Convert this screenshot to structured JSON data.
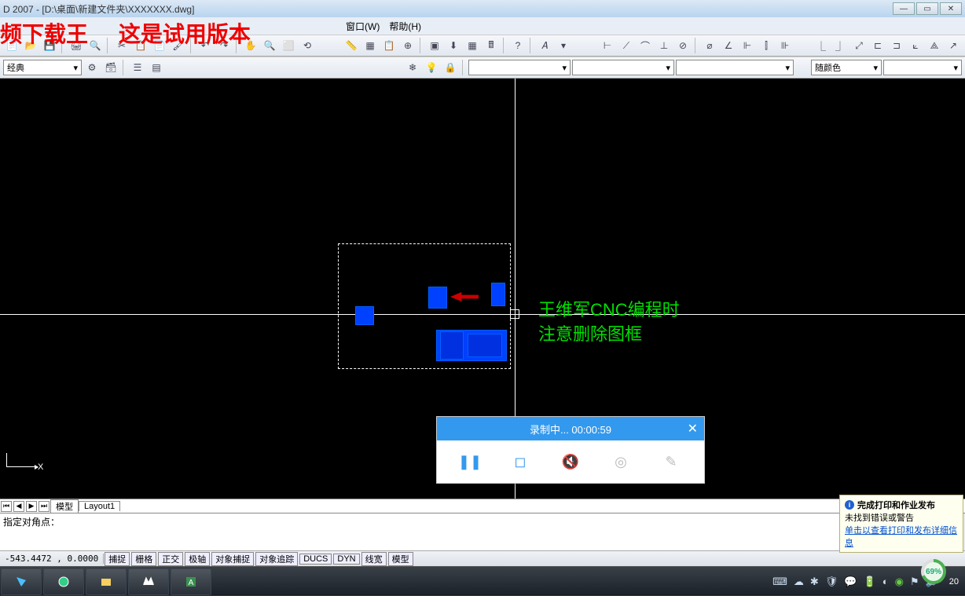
{
  "titlebar": {
    "text": "D 2007 - [D:\\桌面\\新建文件夹\\XXXXXXX.dwg]"
  },
  "overlay": {
    "left": "频下载王",
    "right": "这是试用版本"
  },
  "menu": {
    "window": "窗口(W)",
    "help": "帮助(H)"
  },
  "toolbar2": {
    "style_label": "经典",
    "color_label": "随颜色",
    "layer_input": ""
  },
  "canvas": {
    "axis_x": "X",
    "annotation_line1": "王维军CNC编程时",
    "annotation_line2": "注意删除图框"
  },
  "layout": {
    "tab_model": "模型",
    "tab_layout1": "Layout1"
  },
  "command": {
    "prompt": "指定对角点："
  },
  "notification": {
    "title": "完成打印和作业发布",
    "body": "未找到错误或警告",
    "link": "单击以查看打印和发布详细信息"
  },
  "statusbar": {
    "coords": "-543.4472 , 0.0000",
    "snap": "捕捉",
    "grid": "栅格",
    "ortho": "正交",
    "polar": "极轴",
    "osnap": "对象捕捉",
    "otrack": "对象追踪",
    "ducs": "DUCS",
    "dyn": "DYN",
    "lwt": "线宽",
    "model": "模型"
  },
  "progress": {
    "percent": "69%"
  },
  "recorder": {
    "status": "录制中... 00:00:59"
  },
  "taskbar": {
    "time": "20"
  }
}
